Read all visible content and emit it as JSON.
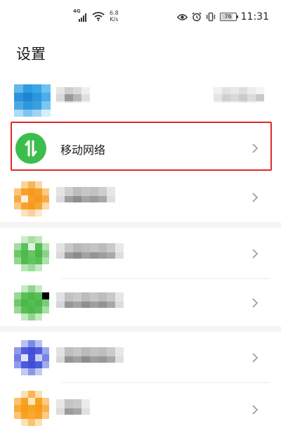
{
  "status_bar": {
    "network_type": "4G",
    "net_speed_value": "6.8",
    "net_speed_unit": "K/s",
    "battery": "76",
    "time": "11:31",
    "icons": [
      "signal-icon",
      "wifi-icon",
      "eye-icon",
      "alarm-icon",
      "vibrate-icon",
      "battery-icon"
    ]
  },
  "header": {
    "title": "设置"
  },
  "settings": {
    "items": [
      {
        "id": "account",
        "label": "",
        "blurred": true
      },
      {
        "id": "mobile-network",
        "label": "移动网络",
        "icon": "mobile-data-icon",
        "icon_color": "#3dbd4c",
        "highlighted": true
      },
      {
        "id": "item-3",
        "label": "",
        "blurred": true
      },
      {
        "id": "item-4",
        "label": "",
        "blurred": true
      },
      {
        "id": "item-5",
        "label": "",
        "blurred": true
      },
      {
        "id": "item-6",
        "label": "",
        "blurred": true
      },
      {
        "id": "item-7",
        "label": "",
        "blurred": true
      }
    ]
  },
  "colors": {
    "highlight_border": "#e02a2a",
    "mobile_network_icon": "#3dbd4c"
  }
}
